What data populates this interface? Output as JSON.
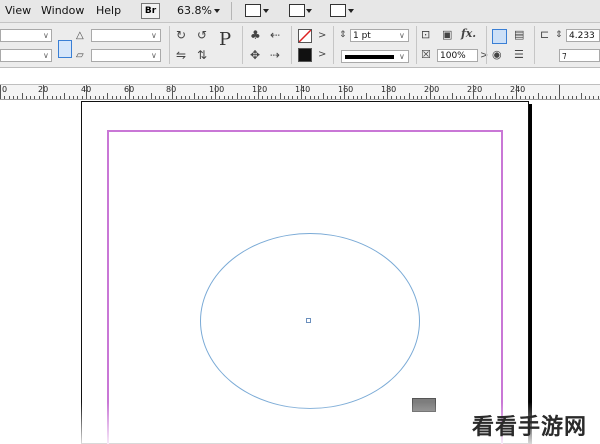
{
  "menu": {
    "items": [
      "View",
      "Window",
      "Help"
    ],
    "bridge_label": "Br",
    "zoom": "63.8%"
  },
  "control": {
    "p_label": "P",
    "stroke_weight": "1 pt",
    "opacity": "100%",
    "fx_label": "fx.",
    "offset_value": "4.233"
  },
  "ruler": {
    "labels": [
      "0",
      "20",
      "40",
      "60",
      "80",
      "100",
      "120",
      "140",
      "160",
      "180",
      "200",
      "220",
      "240"
    ]
  },
  "watermark": "看看手游网",
  "colors": {
    "margin_guide": "#c977d6",
    "ellipse_stroke": "#7aaad6",
    "accent": "#3a7fd5"
  }
}
